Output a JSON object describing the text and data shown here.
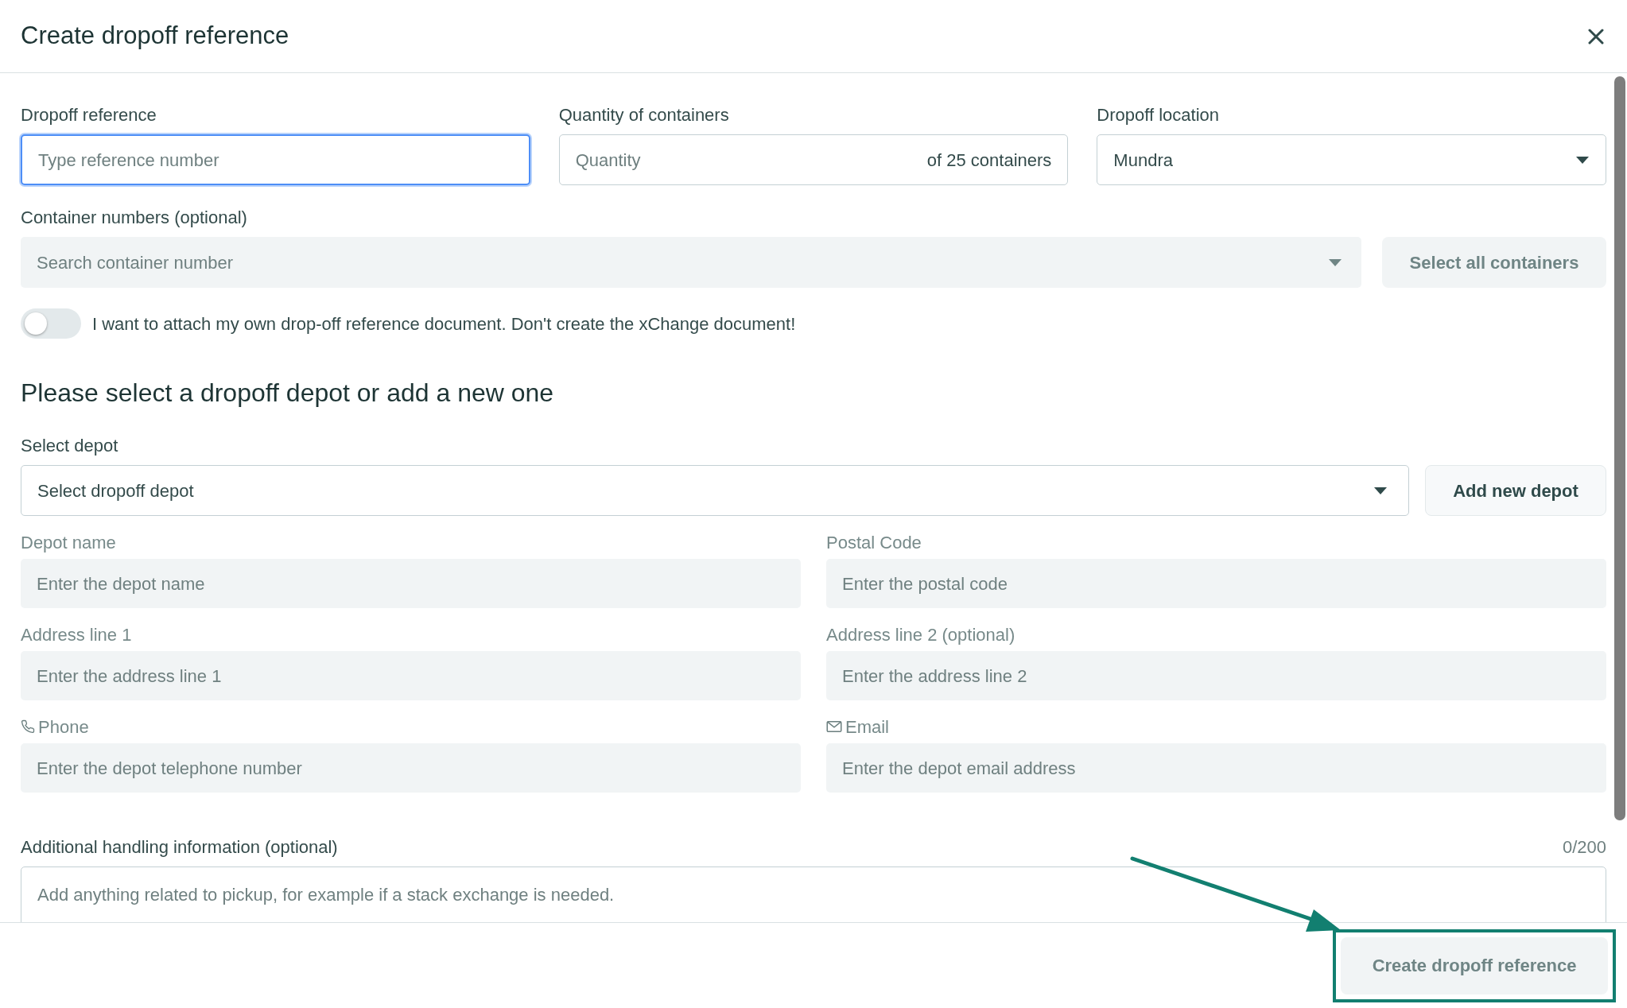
{
  "dialog": {
    "title": "Create dropoff reference"
  },
  "top_fields": [
    {
      "kind": "input",
      "label": "Dropoff reference",
      "placeholder": "Type reference number",
      "focused": true
    },
    {
      "kind": "quantity",
      "label": "Quantity of containers",
      "placeholder": "Quantity",
      "suffix": "of 25 containers",
      "focused": false
    },
    {
      "kind": "select",
      "label": "Dropoff location",
      "value": "Mundra",
      "focused": false
    }
  ],
  "container_numbers": {
    "label": "Container numbers (optional)",
    "placeholder": "Search container number",
    "button": {
      "label": "Select all containers",
      "disabled": true
    }
  },
  "attach_toggle": {
    "label": "I want to attach my own drop-off reference document. Don't create the xChange document!",
    "on": false
  },
  "depot_section": {
    "heading": "Please select a dropoff depot or add a new one",
    "select_label": "Select depot",
    "select_placeholder": "Select dropoff depot",
    "add_button": "Add new depot"
  },
  "depot_fields": [
    {
      "kind": "plain",
      "label": "Depot name",
      "placeholder": "Enter the depot name",
      "disabled": true
    },
    {
      "kind": "plain",
      "label": "Postal Code",
      "placeholder": "Enter the postal code",
      "disabled": true
    },
    {
      "kind": "plain",
      "label": "Address line 1",
      "placeholder": "Enter the address line 1",
      "disabled": true
    },
    {
      "kind": "plain",
      "label": "Address line 2 (optional)",
      "placeholder": "Enter the address line 2",
      "disabled": true
    },
    {
      "kind": "phone",
      "label": "Phone",
      "placeholder": "Enter the depot telephone number",
      "disabled": true
    },
    {
      "kind": "email",
      "label": "Email",
      "placeholder": "Enter the depot email address",
      "disabled": true
    }
  ],
  "additional": {
    "label": "Additional handling information (optional)",
    "counter": "0/200",
    "placeholder": "Add anything related to pickup, for example if a stack exchange is needed."
  },
  "footer": {
    "submit": {
      "label": "Create dropoff reference",
      "disabled": true
    }
  }
}
